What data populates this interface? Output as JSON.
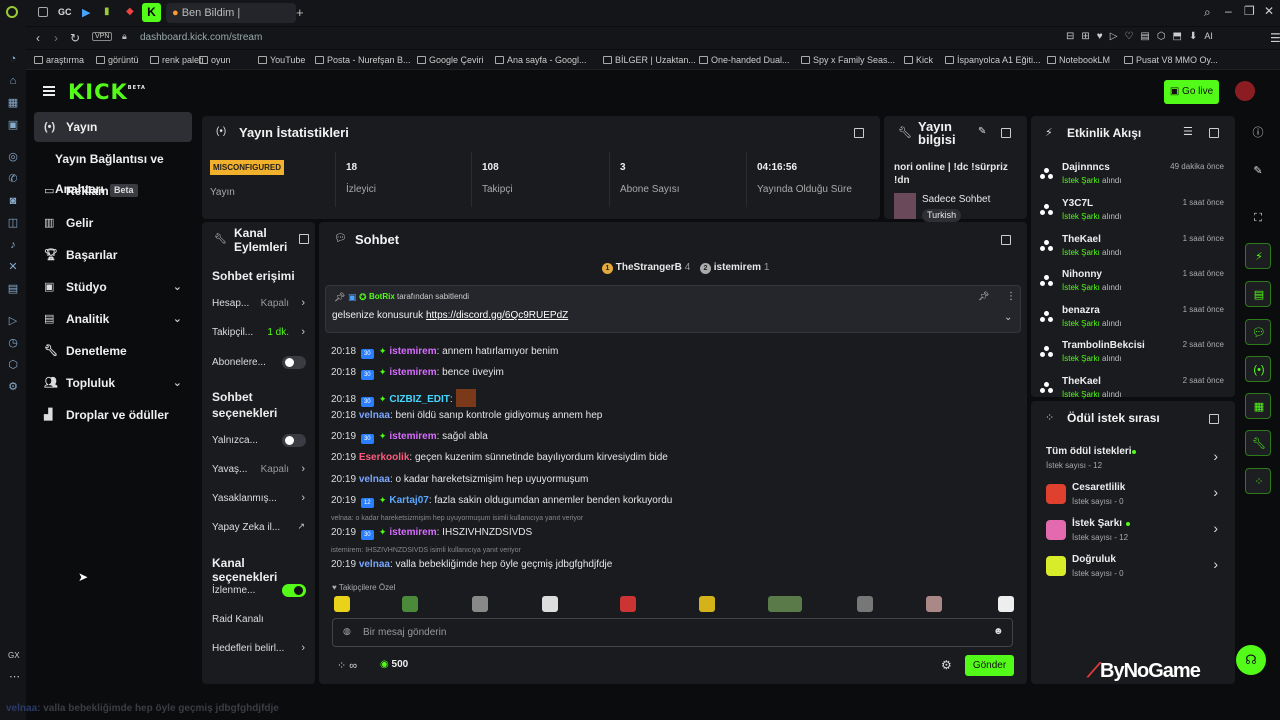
{
  "browser": {
    "tab_title": "Ben Bildim | Arkadaşlarınla",
    "tab_icons": [
      "GC"
    ],
    "url_host": "dashboard.kick.com",
    "url_path": "/stream",
    "vpn_label": "VPN",
    "ai_label": "AI",
    "bookmarks": [
      "araştırma",
      "görüntü",
      "renk paleti",
      "oyun",
      "YouTube",
      "Posta - Nurefşan B...",
      "Google Çeviri",
      "Ana sayfa - Googl...",
      "BİLGER | Uzaktan...",
      "One-handed Dual...",
      "Spy x Family Seas...",
      "Kick",
      "İspanyolca A1 Eğiti...",
      "NotebookLM",
      "Pusat V8 MMO Oy..."
    ],
    "gx_label": "GX"
  },
  "header": {
    "logo": "KICK",
    "logo_sup": "BETA",
    "go_live": "Go live"
  },
  "sidebar": {
    "items": [
      {
        "label": "Yayın",
        "icon": "broadcast-icon"
      },
      {
        "label": "Yayın Bağlantısı ve Anahtarı"
      },
      {
        "label": "Reklam",
        "badge": "Beta",
        "icon": "ad-icon"
      },
      {
        "label": "Gelir",
        "icon": "chart-icon"
      },
      {
        "label": "Başarılar",
        "icon": "trophy-icon"
      },
      {
        "label": "Stüdyo",
        "icon": "studio-icon"
      },
      {
        "label": "Analitik",
        "icon": "analytics-icon"
      },
      {
        "label": "Denetleme",
        "icon": "wrench-icon"
      },
      {
        "label": "Topluluk",
        "icon": "community-icon"
      },
      {
        "label": "Droplar ve ödüller",
        "icon": "drops-icon"
      }
    ]
  },
  "stats": {
    "title": "Yayın İstatistikleri",
    "status_badge": "MISCONFIGURED",
    "status_label": "Yayın",
    "viewers": "18",
    "viewers_label": "İzleyici",
    "followers": "108",
    "followers_label": "Takipçi",
    "subs": "3",
    "subs_label": "Abone Sayısı",
    "uptime": "04:16:56",
    "uptime_label": "Yayında Olduğu Süre"
  },
  "stream_info": {
    "title": "Yayın bilgisi",
    "stream_title": "nori online | !dc !sürpriz !dn",
    "category": "Sadece Sohbet",
    "tag": "Turkish"
  },
  "channel_actions": {
    "title": "Kanal Eylemleri",
    "chat_access": "Sohbet erişimi",
    "rows": [
      {
        "label": "Hesap...",
        "value": "Kapalı"
      },
      {
        "label": "Takipçil...",
        "value": "1 dk."
      },
      {
        "label": "Abonelere..."
      }
    ],
    "chat_options": "Sohbet seçenekleri",
    "rows2": [
      {
        "label": "Yalnızca..."
      },
      {
        "label": "Yavaş...",
        "value": "Kapalı"
      },
      {
        "label": "Yasaklanmış..."
      },
      {
        "label": "Yapay Zeka il..."
      }
    ],
    "channel_options": "Kanal seçenekleri",
    "rows3": [
      {
        "label": "İzlenme..."
      },
      {
        "label": "Raid Kanalı"
      },
      {
        "label": "Hedefleri belirl..."
      }
    ]
  },
  "chat": {
    "title": "Sohbet",
    "top_gifters": [
      {
        "name": "TheStrangerB",
        "count": "4",
        "rank": "1"
      },
      {
        "name": "istemirem",
        "count": "1",
        "rank": "2"
      }
    ],
    "pinned": {
      "by_user": "BotRix",
      "by_text": "tarafından sabitlendi",
      "text": "gelsenize konusuruk",
      "link": "https://discord.gg/6Qc9RUEPdZ"
    },
    "messages": [
      {
        "time": "20:18",
        "badge": "30",
        "user": "istemirem",
        "color": "#d86cff",
        "text": ": annem hatırlamıyor benim"
      },
      {
        "time": "20:18",
        "badge": "30",
        "user": "istemirem",
        "color": "#d86cff",
        "text": ": bence üveyim"
      },
      {
        "time": "20:18",
        "badge": "30",
        "user": "CIZBIZ_EDIT",
        "color": "#45d7ff",
        "text": ":"
      },
      {
        "time": "20:18",
        "user": "velnaa",
        "color": "#7aa6ff",
        "text": ": beni öldü sanıp kontrole gidiyomuş annem hep"
      },
      {
        "time": "20:19",
        "badge": "30",
        "user": "istemirem",
        "color": "#d86cff",
        "text": ": sağol abla"
      },
      {
        "time": "20:19",
        "user": "Eserkoolik",
        "color": "#ff5a7a",
        "text": ": geçen kuzenim sünnetinde bayılıyordum kirvesiydim bide"
      },
      {
        "time": "20:19",
        "user": "velnaa",
        "color": "#7aa6ff",
        "text": ": o kadar hareketsizmişim hep uyuyormuşum"
      },
      {
        "time": "20:19",
        "badge": "12",
        "user": "Kartaj07",
        "color": "#5aa8ff",
        "text": ": fazla sakin oldugumdan annemler benden korkuyordu"
      },
      {
        "reply": "velnaa: o kadar hareketsizmişim hep uyuyormuşum isimli kullanıcıya yanıt veriyor",
        "time": "20:19",
        "badge": "30",
        "user": "istemirem",
        "color": "#d86cff",
        "text": ": IHSZIVHNZDSIVDS"
      },
      {
        "reply": "istemirem: IHSZIVHNZDSIVDS isimli kullanıcıya yanıt veriyor",
        "time": "20:19",
        "user": "velnaa",
        "color": "#7aa6ff",
        "text": ": valla bebekliğimde hep öyle geçmiş jdbgfghdjfdje"
      }
    ],
    "followers_only": "Takipçilere Özel",
    "input_placeholder": "Bir mesaj gönderin",
    "infinity": "∞",
    "points": "500",
    "send": "Gönder"
  },
  "activity": {
    "title": "Etkinlik Akışı",
    "events": [
      {
        "user": "Dajinnncs",
        "text": "alındı",
        "item": "İstek Şarkı",
        "time": "49 dakika önce"
      },
      {
        "user": "Y3C7L",
        "text": "alındı",
        "item": "İstek Şarkı",
        "time": "1 saat önce"
      },
      {
        "user": "TheKael",
        "text": "alındı",
        "item": "İstek Şarkı",
        "time": "1 saat önce"
      },
      {
        "user": "Nihonny",
        "text": "alındı",
        "item": "İstek Şarkı",
        "time": "1 saat önce"
      },
      {
        "user": "benazra",
        "text": "alındı",
        "item": "İstek Şarkı",
        "time": "1 saat önce"
      },
      {
        "user": "TrambolinBekcisi",
        "text": "alındı",
        "item": "İstek Şarkı",
        "time": "2 saat önce"
      },
      {
        "user": "TheKael",
        "text": "alındı",
        "item": "İstek Şarkı",
        "time": "2 saat önce"
      }
    ]
  },
  "rewards": {
    "title": "Ödül istek sırası",
    "items": [
      {
        "name": "Tüm ödül istekleri",
        "count": "İstek sayısı - 12"
      },
      {
        "name": "Cesaretlilik",
        "count": "İstek sayısı - 0",
        "color": "#e0412f"
      },
      {
        "name": "İstek Şarkı",
        "count": "İstek sayısı - 12",
        "color": "#e46ab0"
      },
      {
        "name": "Doğruluk",
        "count": "İstek sayısı - 0",
        "color": "#d9ec2a"
      }
    ]
  },
  "watermark": "ByNoGame",
  "caption": {
    "user": "velnaa",
    "text": ": valla bebekliğimde hep öyle geçmiş jdbgfghdjfdje"
  },
  "colors": {
    "accent": "#53fc18",
    "panel": "#191b1f",
    "bg": "#0b0c0e"
  }
}
